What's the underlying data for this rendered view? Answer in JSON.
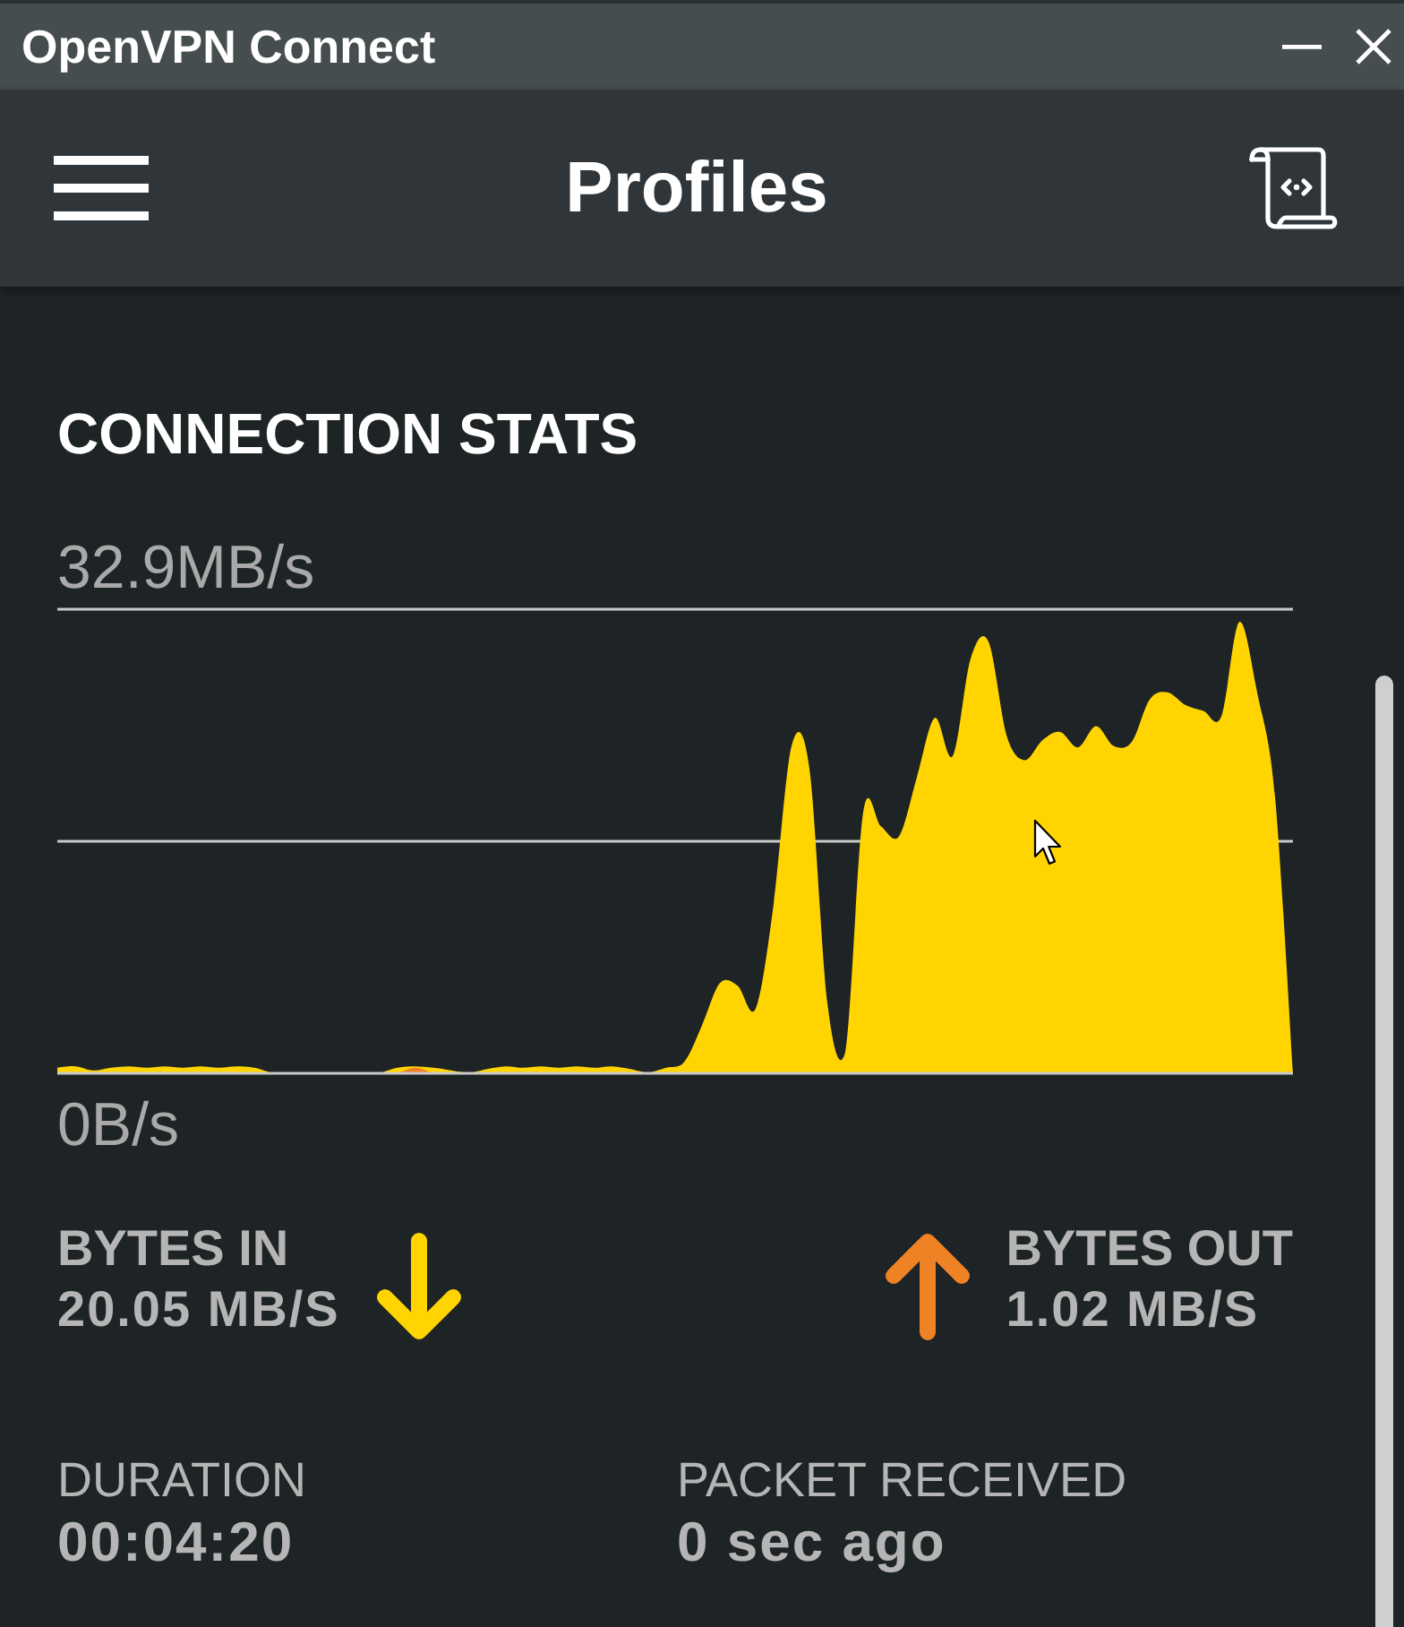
{
  "window": {
    "title": "OpenVPN Connect"
  },
  "header": {
    "title": "Profiles"
  },
  "connection_stats": {
    "heading": "CONNECTION STATS",
    "traffic_graph": {
      "top_label": "32.9MB/s",
      "bottom_label": "0B/s"
    },
    "bytes_in": {
      "label": "BYTES IN",
      "value": "20.05 MB/S"
    },
    "bytes_out": {
      "label": "BYTES OUT",
      "value": "1.02 MB/S"
    },
    "duration": {
      "label": "DURATION",
      "value": "00:04:20"
    },
    "packet_received": {
      "label": "PACKET RECEIVED",
      "value": "0 sec ago"
    }
  }
}
